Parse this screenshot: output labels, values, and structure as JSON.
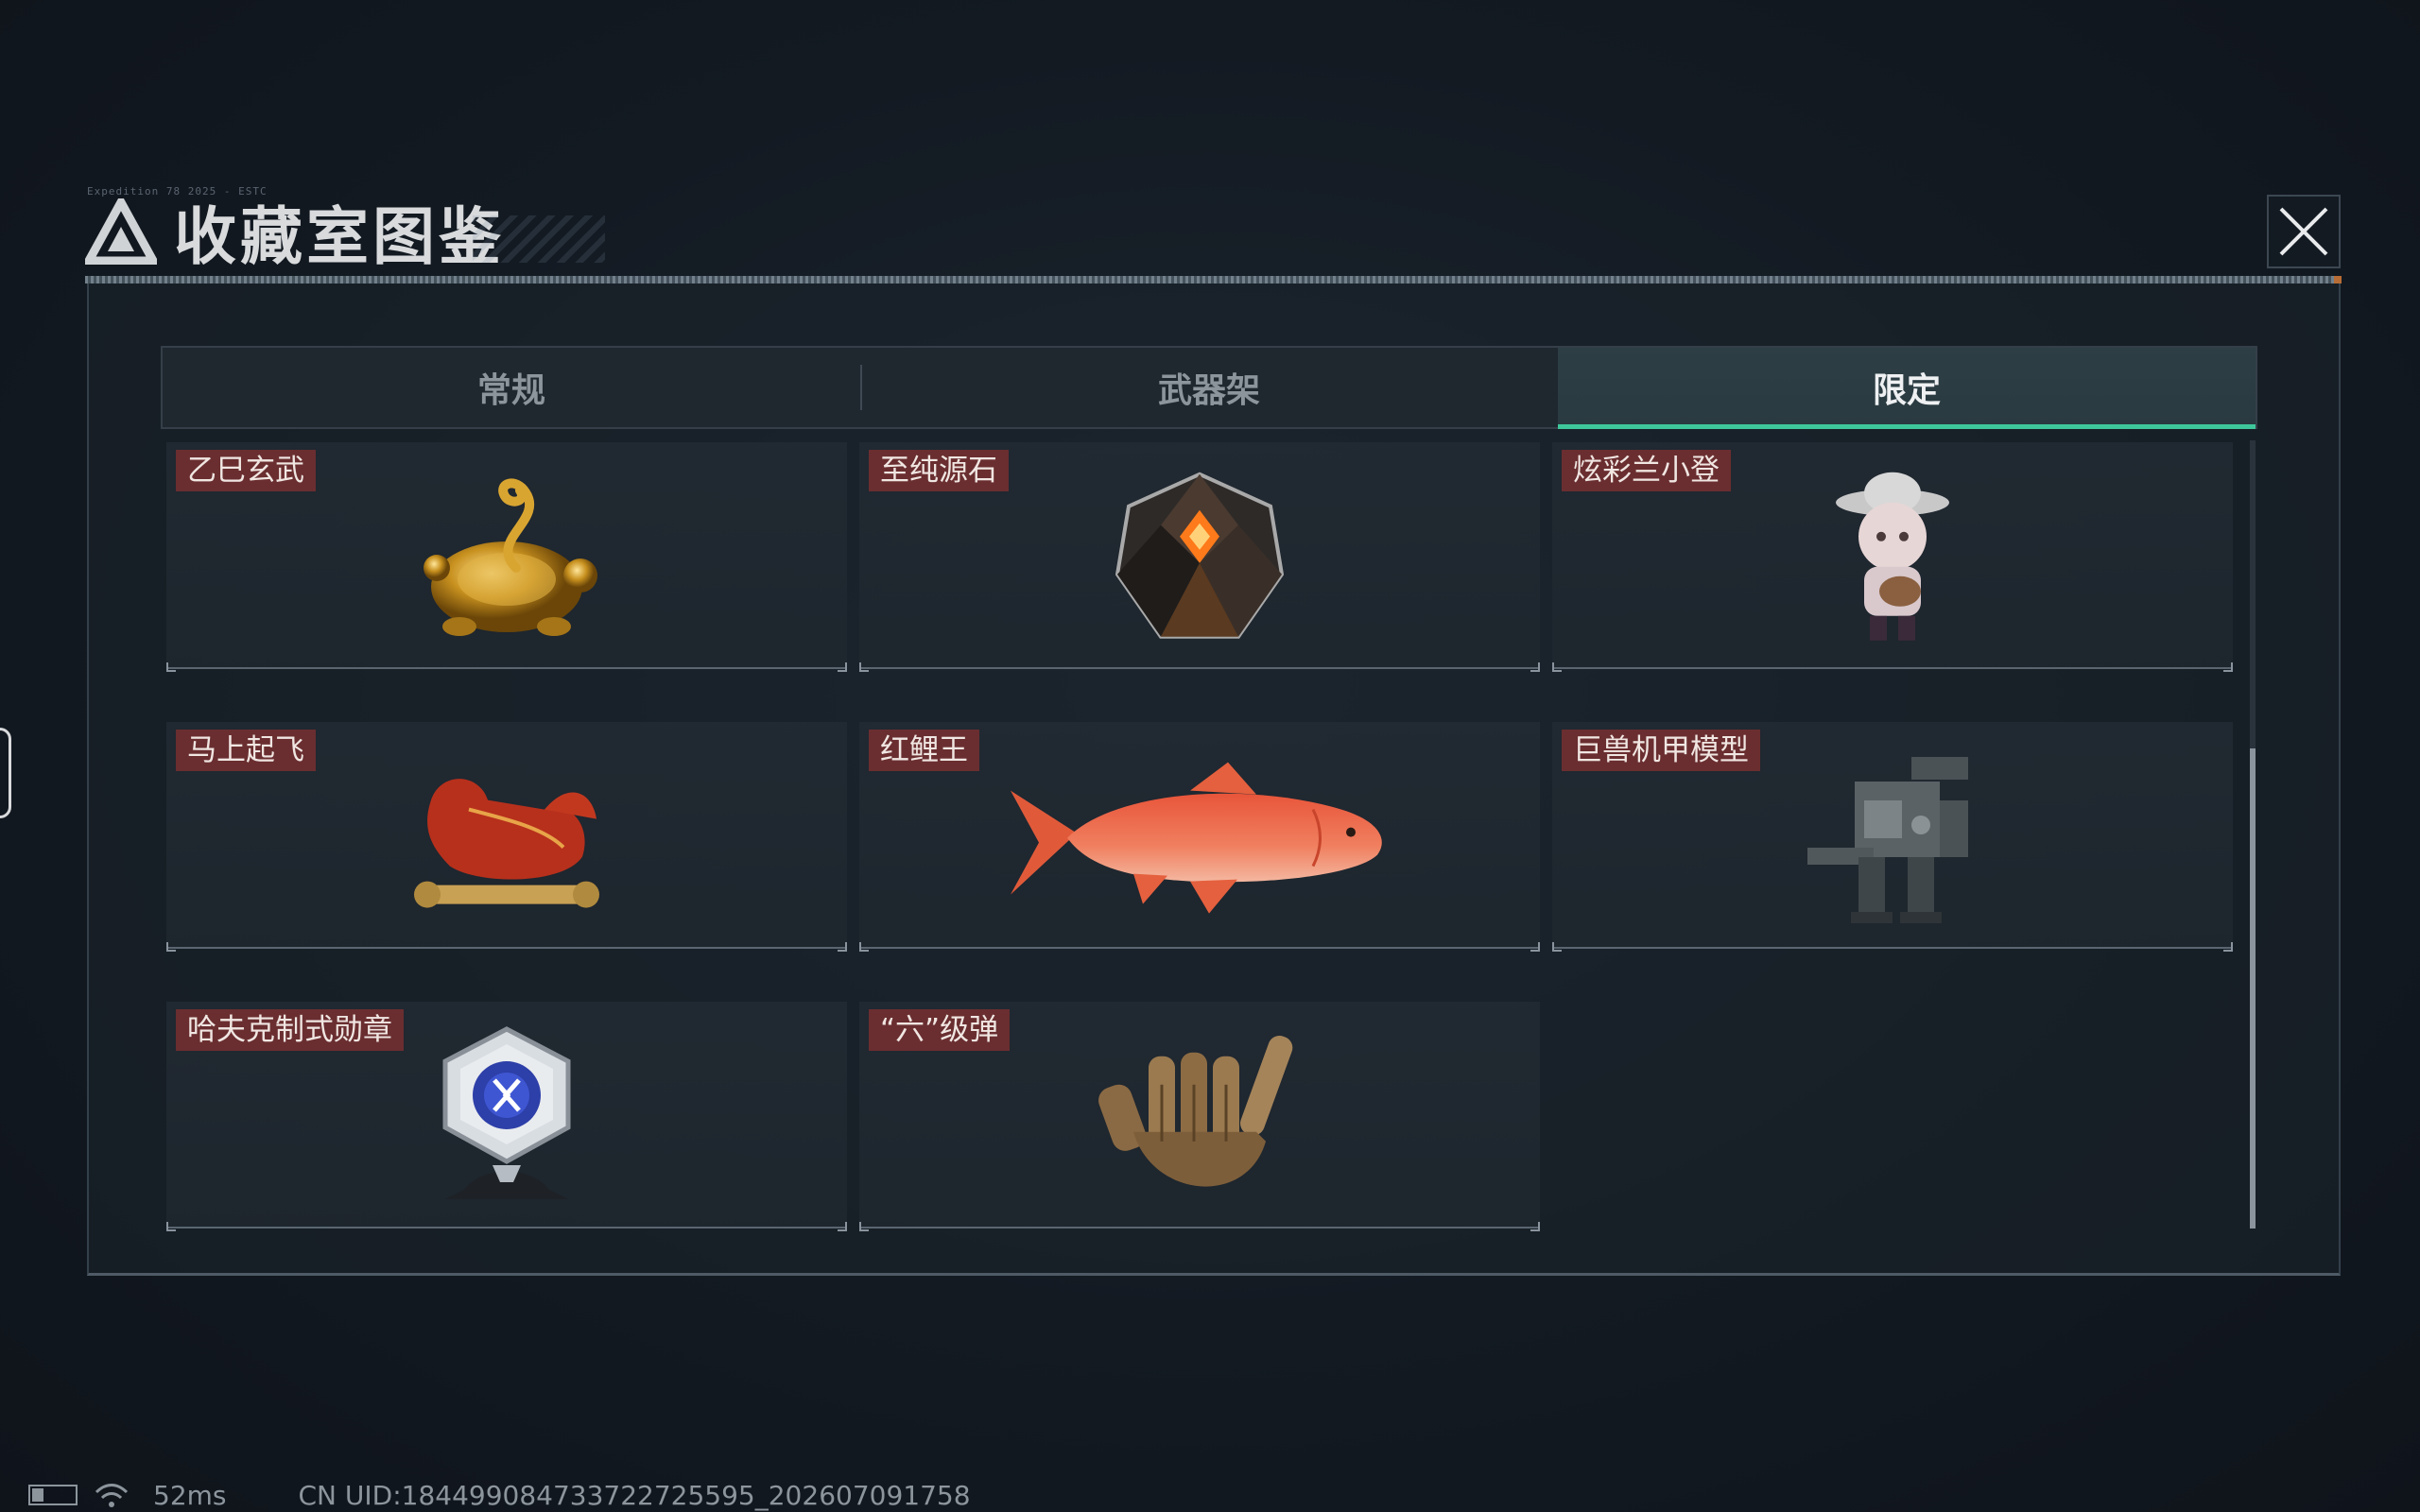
{
  "window": {
    "title": "收藏室图鉴",
    "tiny_caption": "Expedition 78 2025 - ESTC"
  },
  "tabs": [
    {
      "label": "常规",
      "active": false
    },
    {
      "label": "武器架",
      "active": false
    },
    {
      "label": "限定",
      "active": true
    }
  ],
  "items": [
    {
      "name": "乙巳玄武",
      "icon": "golden-turtle-snake-statue"
    },
    {
      "name": "至纯源石",
      "icon": "faceted-dark-gem"
    },
    {
      "name": "炫彩兰小登",
      "icon": "mariachi-figurine"
    },
    {
      "name": "马上起飞",
      "icon": "red-horse-statue"
    },
    {
      "name": "红鲤王",
      "icon": "red-carp-fish"
    },
    {
      "name": "巨兽机甲模型",
      "icon": "mech-model"
    },
    {
      "name": "哈夫克制式勋章",
      "icon": "hexagon-medal"
    },
    {
      "name": "“六”级弹",
      "icon": "bullet-hand-sculpture"
    }
  ],
  "footer": {
    "ping": "52ms",
    "uid": "CN UID:1844990847337227255​95_202607091758"
  },
  "colors": {
    "accent": "#3ec79b",
    "label_bg": "#6a2e30",
    "warning_tick": "#e0823a"
  }
}
